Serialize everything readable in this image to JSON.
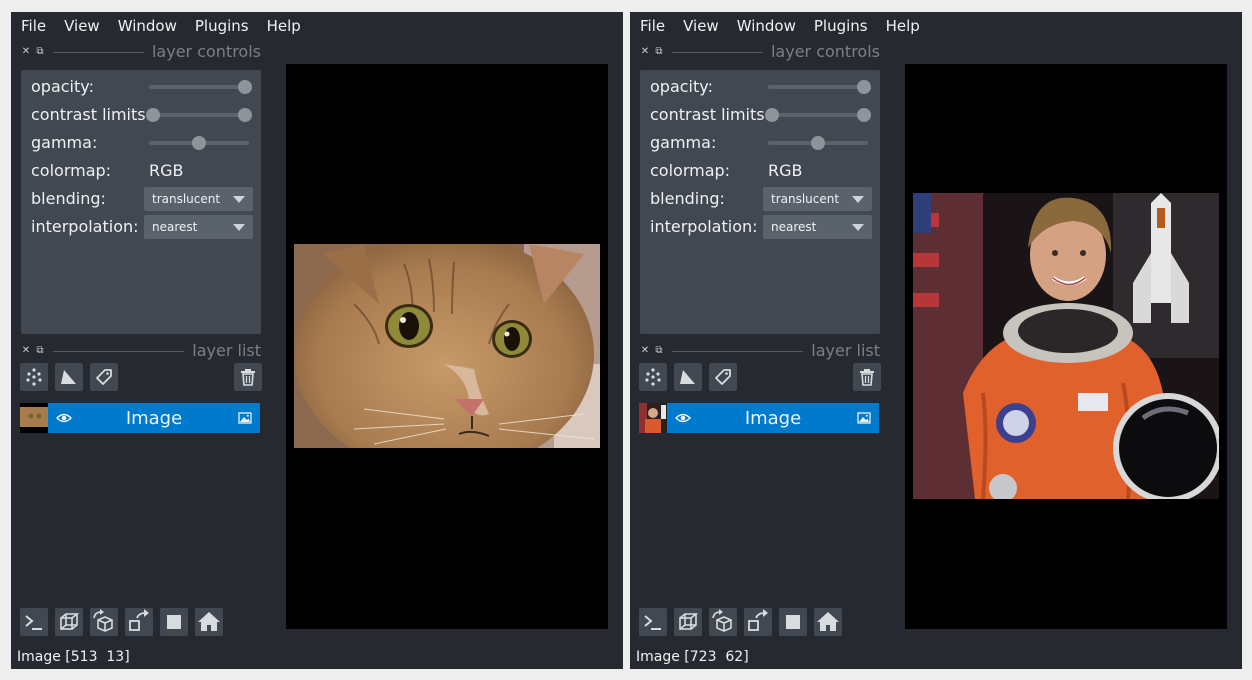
{
  "windows": [
    {
      "menu": [
        "File",
        "View",
        "Window",
        "Plugins",
        "Help"
      ],
      "controls_title": "layer controls",
      "controls": {
        "opacity_label": "opacity:",
        "opacity_value": 1.0,
        "contrast_label": "contrast limits:",
        "contrast_min": 0.0,
        "contrast_max": 1.0,
        "gamma_label": "gamma:",
        "gamma_value": 0.5,
        "colormap_label": "colormap:",
        "colormap_value": "RGB",
        "blending_label": "blending:",
        "blending_value": "translucent",
        "interpolation_label": "interpolation:",
        "interpolation_value": "nearest"
      },
      "list_title": "layer list",
      "layer": {
        "name": "Image",
        "visible": true,
        "thumbnail": "cat"
      },
      "canvas_image": "cat",
      "status": "Image [513  13]"
    },
    {
      "menu": [
        "File",
        "View",
        "Window",
        "Plugins",
        "Help"
      ],
      "controls_title": "layer controls",
      "controls": {
        "opacity_label": "opacity:",
        "opacity_value": 1.0,
        "contrast_label": "contrast limits:",
        "contrast_min": 0.0,
        "contrast_max": 1.0,
        "gamma_label": "gamma:",
        "gamma_value": 0.5,
        "colormap_label": "colormap:",
        "colormap_value": "RGB",
        "blending_label": "blending:",
        "blending_value": "translucent",
        "interpolation_label": "interpolation:",
        "interpolation_value": "nearest"
      },
      "list_title": "layer list",
      "layer": {
        "name": "Image",
        "visible": true,
        "thumbnail": "astronaut"
      },
      "canvas_image": "astronaut",
      "status": "Image [723  62]"
    }
  ],
  "icons": {
    "dock_close": "close-icon",
    "dock_float": "float-icon",
    "new_points": "new-points-icon",
    "new_shapes": "new-shapes-icon",
    "new_labels": "new-labels-icon",
    "delete_layer": "trash-icon",
    "visibility": "eye-icon",
    "layer_type": "image-type-icon",
    "console": "console-icon",
    "ndisplay": "ndisplay-cube-icon",
    "roll": "roll-dims-icon",
    "transpose": "transpose-dims-icon",
    "grid": "grid-square-icon",
    "home": "home-icon"
  },
  "colors": {
    "background": "#262930",
    "panel": "#414851",
    "selected_layer": "#007acc",
    "text": "#f0f1f2",
    "canvas": "#000000"
  }
}
